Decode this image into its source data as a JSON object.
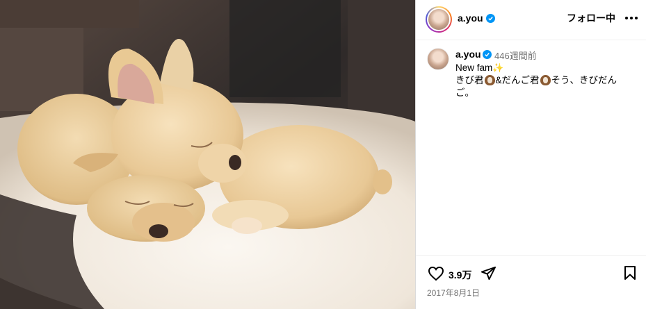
{
  "post": {
    "image_alt": "Two cream French bulldog puppies sleeping on a white blanket",
    "username": "a.you",
    "follow_label": "フォロー中",
    "caption_time": "446週間前",
    "caption_line1": "New fam",
    "caption_line2_part1": "きび君",
    "caption_line2_part2": "&だんご君",
    "caption_line2_part3": "そう、きびだん",
    "caption_line3": "ご。",
    "like_count": "3.9万",
    "date": "2017年8月1日"
  },
  "icons": {
    "more": "more-options-icon",
    "verified": "verified-badge-icon",
    "like": "heart-icon",
    "share": "paper-plane-icon",
    "save": "bookmark-icon"
  },
  "colors": {
    "verified": "#0095f6",
    "secondary_text": "#737373",
    "border": "#dbdbdb"
  }
}
